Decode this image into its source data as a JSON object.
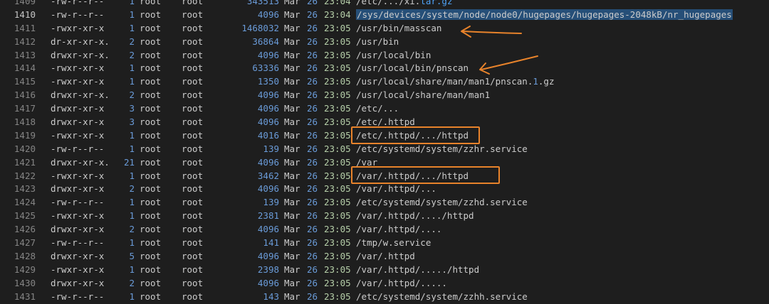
{
  "listing": [
    {
      "ln": "1409",
      "perm": "-rw-r--r--",
      "links": "1",
      "owner": "root",
      "group": "root",
      "size": "343513",
      "month": "Mar",
      "day": "26",
      "time": "23:04",
      "path": "/etc/.../xi.",
      "path_ext": "tar.gz",
      "path_after": ""
    },
    {
      "ln": "1410",
      "perm": "-rw-r--r--",
      "links": "1",
      "owner": "root",
      "group": "root",
      "size": "4096",
      "month": "Mar",
      "day": "26",
      "time": "23:04",
      "path": "/sys/devices/system/node/node0/hugepages/hugepages-2048kB/nr_hugepages",
      "current": true,
      "selected": true
    },
    {
      "ln": "1411",
      "perm": "-rwxr-xr-x",
      "links": "1",
      "owner": "root",
      "group": "root",
      "size": "1468032",
      "month": "Mar",
      "day": "26",
      "time": "23:05",
      "path": "/usr/bin/masscan"
    },
    {
      "ln": "1412",
      "perm": "dr-xr-xr-x.",
      "links": "2",
      "owner": "root",
      "group": "root",
      "size": "36864",
      "month": "Mar",
      "day": "26",
      "time": "23:05",
      "path": "/usr/bin"
    },
    {
      "ln": "1413",
      "perm": "drwxr-xr-x.",
      "links": "2",
      "owner": "root",
      "group": "root",
      "size": "4096",
      "month": "Mar",
      "day": "26",
      "time": "23:05",
      "path": "/usr/local/bin"
    },
    {
      "ln": "1414",
      "perm": "-rwxr-xr-x",
      "links": "1",
      "owner": "root",
      "group": "root",
      "size": "63336",
      "month": "Mar",
      "day": "26",
      "time": "23:05",
      "path": "/usr/local/bin/pnscan"
    },
    {
      "ln": "1415",
      "perm": "-rwxr-xr-x",
      "links": "1",
      "owner": "root",
      "group": "root",
      "size": "1350",
      "month": "Mar",
      "day": "26",
      "time": "23:05",
      "path": "/usr/local/share/man/man1/pnscan.",
      "path_num": "1",
      "path_after": ".gz"
    },
    {
      "ln": "1416",
      "perm": "drwxr-xr-x.",
      "links": "2",
      "owner": "root",
      "group": "root",
      "size": "4096",
      "month": "Mar",
      "day": "26",
      "time": "23:05",
      "path": "/usr/local/share/man/man1"
    },
    {
      "ln": "1417",
      "perm": "drwxr-xr-x",
      "links": "3",
      "owner": "root",
      "group": "root",
      "size": "4096",
      "month": "Mar",
      "day": "26",
      "time": "23:05",
      "path": "/etc/..."
    },
    {
      "ln": "1418",
      "perm": "drwxr-xr-x",
      "links": "3",
      "owner": "root",
      "group": "root",
      "size": "4096",
      "month": "Mar",
      "day": "26",
      "time": "23:05",
      "path": "/etc/.httpd"
    },
    {
      "ln": "1419",
      "perm": "-rwxr-xr-x",
      "links": "1",
      "owner": "root",
      "group": "root",
      "size": "4016",
      "month": "Mar",
      "day": "26",
      "time": "23:05",
      "path": "/etc/.httpd/.../httpd"
    },
    {
      "ln": "1420",
      "perm": "-rw-r--r--",
      "links": "1",
      "owner": "root",
      "group": "root",
      "size": "139",
      "month": "Mar",
      "day": "26",
      "time": "23:05",
      "path": "/etc/systemd/system/zzhr.service"
    },
    {
      "ln": "1421",
      "perm": "drwxr-xr-x.",
      "links": "21",
      "owner": "root",
      "group": "root",
      "size": "4096",
      "month": "Mar",
      "day": "26",
      "time": "23:05",
      "path": "/var"
    },
    {
      "ln": "1422",
      "perm": "-rwxr-xr-x",
      "links": "1",
      "owner": "root",
      "group": "root",
      "size": "3462",
      "month": "Mar",
      "day": "26",
      "time": "23:05",
      "path": "/var/.httpd/.../httpd"
    },
    {
      "ln": "1423",
      "perm": "drwxr-xr-x",
      "links": "2",
      "owner": "root",
      "group": "root",
      "size": "4096",
      "month": "Mar",
      "day": "26",
      "time": "23:05",
      "path": "/var/.httpd/..."
    },
    {
      "ln": "1424",
      "perm": "-rw-r--r--",
      "links": "1",
      "owner": "root",
      "group": "root",
      "size": "139",
      "month": "Mar",
      "day": "26",
      "time": "23:05",
      "path": "/etc/systemd/system/zzhd.service"
    },
    {
      "ln": "1425",
      "perm": "-rwxr-xr-x",
      "links": "1",
      "owner": "root",
      "group": "root",
      "size": "2381",
      "month": "Mar",
      "day": "26",
      "time": "23:05",
      "path": "/var/.httpd/..../httpd"
    },
    {
      "ln": "1426",
      "perm": "drwxr-xr-x",
      "links": "2",
      "owner": "root",
      "group": "root",
      "size": "4096",
      "month": "Mar",
      "day": "26",
      "time": "23:05",
      "path": "/var/.httpd/...."
    },
    {
      "ln": "1427",
      "perm": "-rw-r--r--",
      "links": "1",
      "owner": "root",
      "group": "root",
      "size": "141",
      "month": "Mar",
      "day": "26",
      "time": "23:05",
      "path": "/tmp/w.service"
    },
    {
      "ln": "1428",
      "perm": "drwxr-xr-x",
      "links": "5",
      "owner": "root",
      "group": "root",
      "size": "4096",
      "month": "Mar",
      "day": "26",
      "time": "23:05",
      "path": "/var/.httpd"
    },
    {
      "ln": "1429",
      "perm": "-rwxr-xr-x",
      "links": "1",
      "owner": "root",
      "group": "root",
      "size": "2398",
      "month": "Mar",
      "day": "26",
      "time": "23:05",
      "path": "/var/.httpd/...../httpd"
    },
    {
      "ln": "1430",
      "perm": "drwxr-xr-x",
      "links": "2",
      "owner": "root",
      "group": "root",
      "size": "4096",
      "month": "Mar",
      "day": "26",
      "time": "23:05",
      "path": "/var/.httpd/....."
    },
    {
      "ln": "1431",
      "perm": "-rw-r--r--",
      "links": "1",
      "owner": "root",
      "group": "root",
      "size": "143",
      "month": "Mar",
      "day": "26",
      "time": "23:05",
      "path": "/etc/systemd/system/zzhh.service"
    }
  ],
  "colors": {
    "background": "#1e1e1e",
    "annotation": "#e8832b",
    "selection": "#264f78",
    "number": "#6a9bd8",
    "time": "#b5cea8"
  },
  "annotations": {
    "arrow_rows": [
      "1411",
      "1414"
    ],
    "boxed_rows": [
      "1419",
      "1422"
    ]
  }
}
